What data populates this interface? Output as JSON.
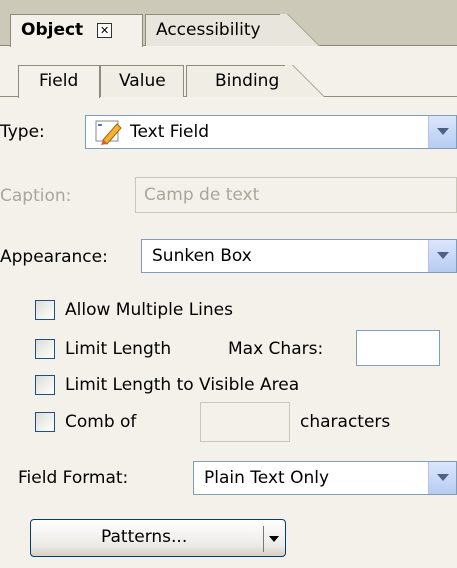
{
  "outer_tabs": [
    {
      "label": "Object",
      "active": true
    },
    {
      "label": "Accessibility",
      "active": false
    }
  ],
  "inner_tabs": [
    {
      "label": "Field",
      "active": true
    },
    {
      "label": "Value",
      "active": false
    },
    {
      "label": "Binding",
      "active": false
    }
  ],
  "type": {
    "label": "Type:",
    "value": "Text Field",
    "icon": "text-field-icon"
  },
  "caption": {
    "label": "Caption:",
    "value": "Camp de text",
    "disabled": true
  },
  "appearance": {
    "label": "Appearance:",
    "value": "Sunken Box"
  },
  "options": [
    {
      "label": "Allow Multiple Lines",
      "checked": false
    },
    {
      "label": "Limit Length",
      "checked": false
    },
    {
      "label": "Limit Length to Visible Area",
      "checked": false
    },
    {
      "label": "Comb of",
      "checked": false
    }
  ],
  "max_chars": {
    "label": "Max Chars:",
    "value": ""
  },
  "comb": {
    "value": "",
    "suffix": "characters"
  },
  "field_format": {
    "label": "Field Format:",
    "value": "Plain Text Only"
  },
  "patterns_button": {
    "label": "Patterns..."
  },
  "colors": {
    "panel_bg": "#f3f1ea",
    "tabstrip_bg": "#ccc9b9",
    "border": "#7f9db9",
    "combo_button": "#b7ccf3"
  }
}
